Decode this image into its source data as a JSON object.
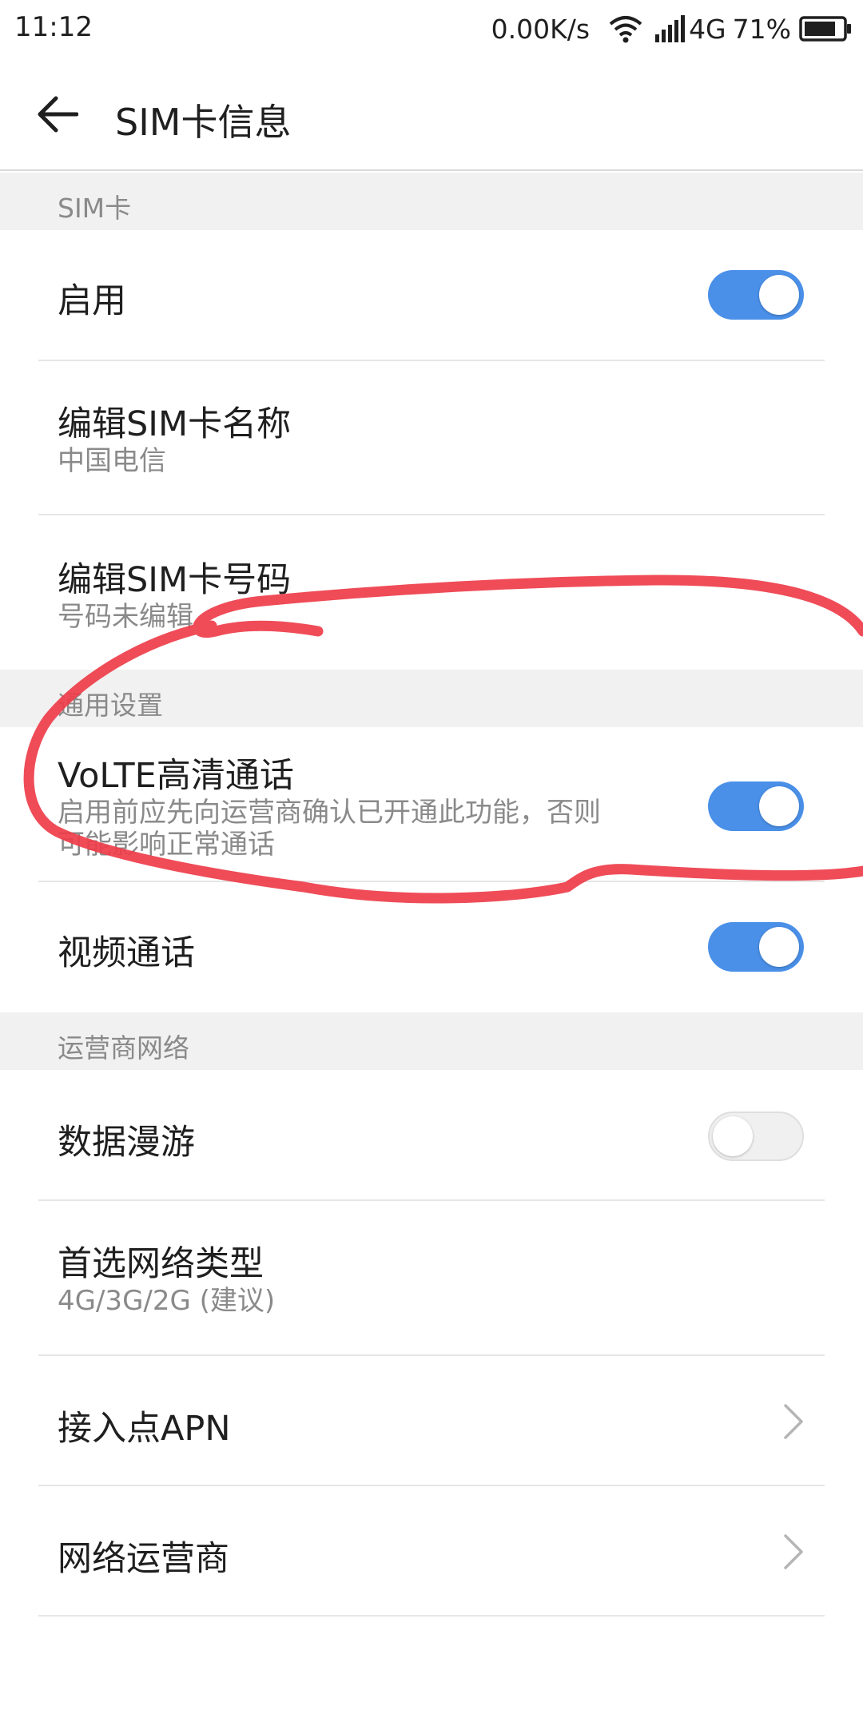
{
  "status_bar": {
    "time": "11:12",
    "net_speed": "0.00K/s",
    "network_type": "4G",
    "battery": "71%"
  },
  "header": {
    "title": "SIM卡信息"
  },
  "sections": {
    "sim": {
      "header": "SIM卡"
    },
    "general": {
      "header": "通用设置"
    },
    "carrier": {
      "header": "运营商网络"
    }
  },
  "rows": {
    "enable": {
      "title": "启用",
      "toggle_on": true
    },
    "sim_name": {
      "title": "编辑SIM卡名称",
      "subtitle": "中国电信"
    },
    "sim_number": {
      "title": "编辑SIM卡号码",
      "subtitle": "号码未编辑"
    },
    "volte": {
      "title": "VoLTE高清通话",
      "subtitle_line1": "启用前应先向运营商确认已开通此功能，否则",
      "subtitle_line2": "可能影响正常通话",
      "toggle_on": true
    },
    "video_call": {
      "title": "视频通话",
      "toggle_on": true
    },
    "data_roaming": {
      "title": "数据漫游",
      "toggle_on": false
    },
    "preferred_network": {
      "title": "首选网络类型",
      "subtitle": "4G/3G/2G (建议)"
    },
    "apn": {
      "title": "接入点APN"
    },
    "carrier": {
      "title": "网络运营商"
    }
  },
  "colors": {
    "toggle_on": "#4a90e8",
    "annotation_stroke": "#ee3d4a"
  }
}
